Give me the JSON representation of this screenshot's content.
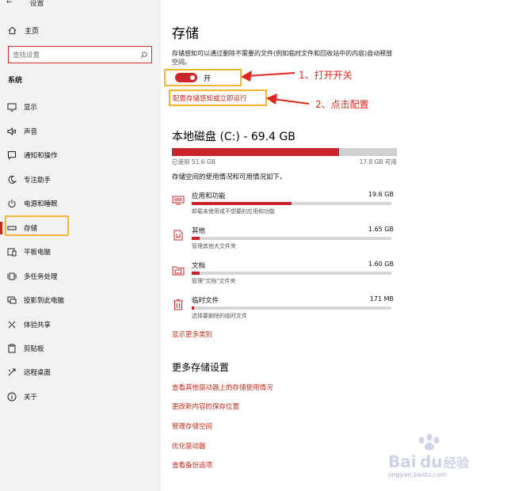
{
  "window": {
    "title": "设置"
  },
  "sidebar": {
    "home": "主页",
    "search_placeholder": "查找设置",
    "section": "系统",
    "items": [
      {
        "label": "显示",
        "icon": "monitor-icon"
      },
      {
        "label": "声音",
        "icon": "speaker-icon"
      },
      {
        "label": "通知和操作",
        "icon": "notification-icon"
      },
      {
        "label": "专注助手",
        "icon": "moon-icon"
      },
      {
        "label": "电源和睡眠",
        "icon": "power-icon"
      },
      {
        "label": "存储",
        "icon": "storage-icon",
        "active": true
      },
      {
        "label": "平板电脑",
        "icon": "tablet-icon"
      },
      {
        "label": "多任务处理",
        "icon": "multitask-icon"
      },
      {
        "label": "投影到此电脑",
        "icon": "project-icon"
      },
      {
        "label": "体验共享",
        "icon": "share-icon"
      },
      {
        "label": "剪贴板",
        "icon": "clipboard-icon"
      },
      {
        "label": "远程桌面",
        "icon": "remote-icon"
      },
      {
        "label": "关于",
        "icon": "info-icon"
      }
    ]
  },
  "main": {
    "title": "存储",
    "description": "存储感知可以通过删除不需要的文件(例如临时文件和回收站中的内容)自动释放空间。",
    "toggle": {
      "state": "开",
      "on": true
    },
    "config_link": "配置存储感知或立即运行",
    "annotation_1": "1、打开开关",
    "annotation_2": "2、点击配置",
    "disk": {
      "title": "本地磁盘 (C:) - 69.4 GB",
      "used_label": "已使用 51.6 GB",
      "free_label": "17.8 GB 可用",
      "used_fraction": 0.744
    },
    "usage_desc": "存储空间的使用情况和可用情况如下。",
    "categories": [
      {
        "name": "应用和功能",
        "size": "19.6 GB",
        "sub": "卸载未使用或不想要的应用和功能",
        "fraction": 0.5,
        "icon": "apps-icon"
      },
      {
        "name": "其他",
        "size": "1.65 GB",
        "sub": "管理其他大文件夹",
        "fraction": 0.04,
        "icon": "other-icon"
      },
      {
        "name": "文档",
        "size": "1.60 GB",
        "sub": "管理\"文档\"文件夹",
        "fraction": 0.04,
        "icon": "documents-icon"
      },
      {
        "name": "临时文件",
        "size": "171 MB",
        "sub": "选择要删除的临时文件",
        "fraction": 0.01,
        "icon": "trash-icon"
      }
    ],
    "show_more": "显示更多类别",
    "more_settings_title": "更多存储设置",
    "more_links": [
      "查看其他驱动器上的存储使用情况",
      "更改新内容的保存位置",
      "管理存储空间",
      "优化驱动器",
      "查看备份选项"
    ]
  },
  "watermark": {
    "text": "Baidu经验",
    "sub": "jingyan.baidu.com"
  },
  "colors": {
    "accent": "#c42b1c",
    "highlight": "#f2b52f",
    "annotation": "#e3261c"
  }
}
